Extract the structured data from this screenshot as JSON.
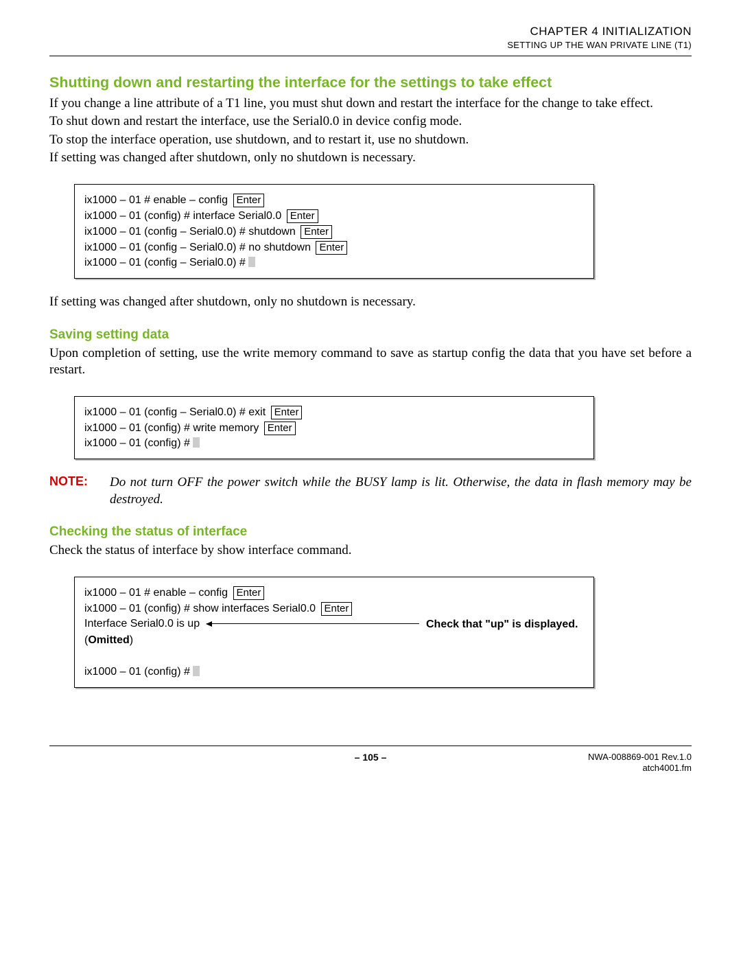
{
  "header": {
    "chapter": "CHAPTER 4   INITIALIZATION",
    "subchapter": "SETTING UP THE WAN PRIVATE LINE (T1)"
  },
  "section1": {
    "heading": "Shutting down and restarting the interface for the settings to take effect",
    "p1": "If you change a line attribute of a T1 line, you must shut down and restart the interface for the change to take effect.",
    "p2": "To shut down and restart the interface, use the Serial0.0 in device config mode.",
    "p3": "To stop the interface operation, use shutdown, and to restart it, use no shutdown.",
    "p4": "If setting was changed after shutdown, only no shutdown is necessary.",
    "code": {
      "l1": "ix1000 – 01 # enable – config",
      "l2": "ix1000 – 01 (config) # interface Serial0.0",
      "l3": "ix1000 – 01 (config – Serial0.0) # shutdown",
      "l4": "ix1000 – 01 (config – Serial0.0) # no shutdown",
      "l5": "ix1000 – 01 (config – Serial0.0) #"
    },
    "p5": "If setting was changed after shutdown, only no shutdown is necessary."
  },
  "section2": {
    "heading": "Saving setting data",
    "p1": "Upon completion of setting, use the write memory command to save as startup config the data that you have set before a restart.",
    "code": {
      "l1": "ix1000 – 01 (config – Serial0.0) # exit",
      "l2": "ix1000 – 01 (config) # write memory",
      "l3": "ix1000 – 01 (config) #"
    }
  },
  "note": {
    "label": "NOTE:",
    "text": "Do not turn OFF the power switch while the BUSY lamp is lit. Otherwise, the data in flash memory may be destroyed."
  },
  "section3": {
    "heading": "Checking the status of interface",
    "p1": "Check the status of interface by show interface command.",
    "code": {
      "l1": "ix1000 – 01 # enable – config",
      "l2": "ix1000 – 01 (config) # show interfaces Serial0.0",
      "status": "Interface Serial0.0 is up",
      "check": "Check that \"up\" is displayed.",
      "omitted1": "(",
      "omitted2": "Omitted",
      "omitted3": ")",
      "l5": "ix1000 – 01 (config) #"
    }
  },
  "enter": "Enter",
  "footer": {
    "page": "– 105 –",
    "doc": "NWA-008869-001 Rev.1.0",
    "file": "atch4001.fm"
  }
}
